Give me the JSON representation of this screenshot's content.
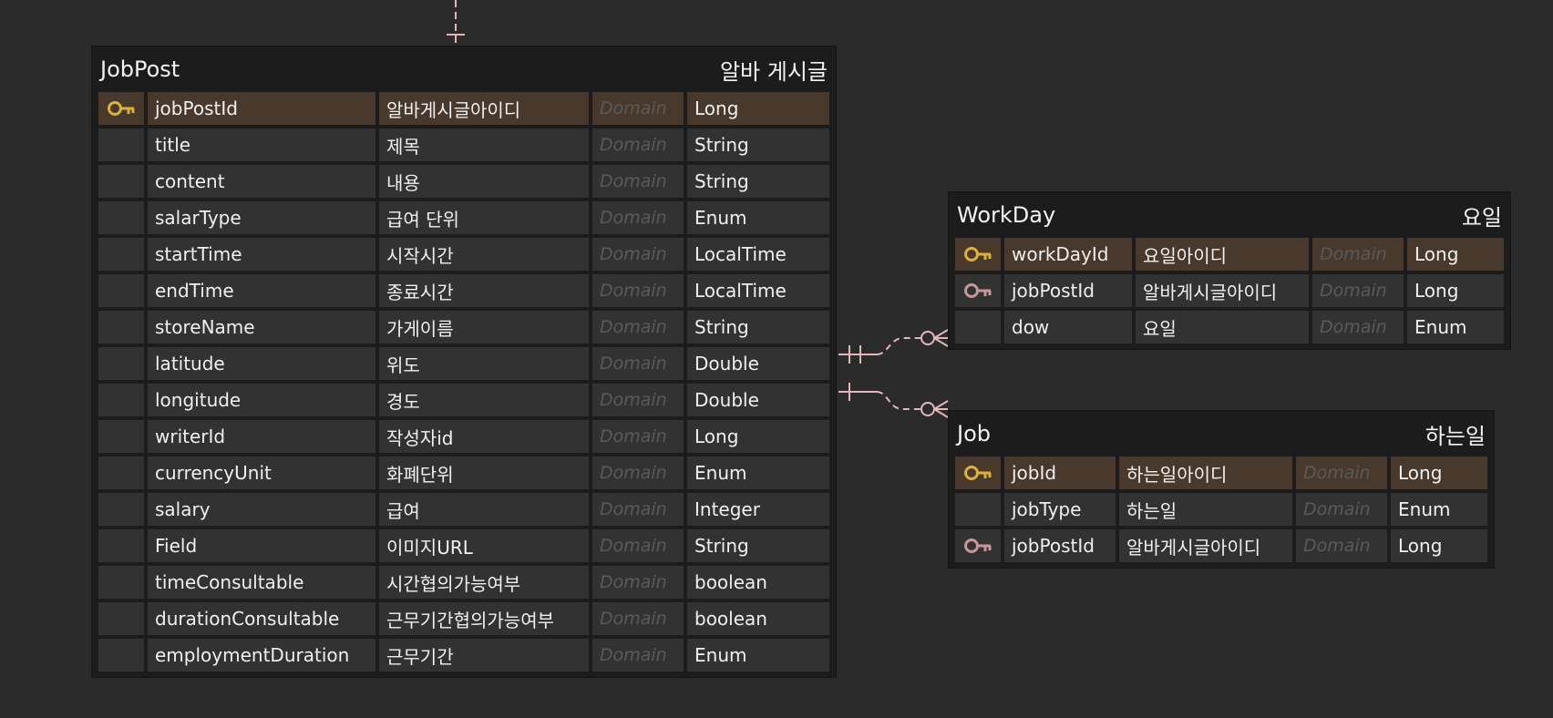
{
  "colors": {
    "background": "#2b2b2b",
    "table": "#1c1c1c",
    "cell": "#323232",
    "pk_cell": "#48392c",
    "pk_key": "#d9b13c",
    "fk_key": "#c9959d",
    "connector": "#e3b6bd"
  },
  "icons": {
    "pk": "key-icon",
    "fk": "foreign-key-icon"
  },
  "tables": [
    {
      "id": "jobpost",
      "name": "JobPost",
      "logical": "알바 게시글",
      "rows": [
        {
          "key": "pk",
          "column": "jobPostId",
          "logical": "알바게시글아이디",
          "domain": "Domain",
          "type": "Long"
        },
        {
          "key": "",
          "column": "title",
          "logical": "제목",
          "domain": "Domain",
          "type": "String"
        },
        {
          "key": "",
          "column": "content",
          "logical": "내용",
          "domain": "Domain",
          "type": "String"
        },
        {
          "key": "",
          "column": "salarType",
          "logical": "급여 단위",
          "domain": "Domain",
          "type": "Enum"
        },
        {
          "key": "",
          "column": "startTime",
          "logical": "시작시간",
          "domain": "Domain",
          "type": "LocalTime"
        },
        {
          "key": "",
          "column": "endTime",
          "logical": "종료시간",
          "domain": "Domain",
          "type": "LocalTime"
        },
        {
          "key": "",
          "column": "storeName",
          "logical": "가게이름",
          "domain": "Domain",
          "type": "String"
        },
        {
          "key": "",
          "column": "latitude",
          "logical": "위도",
          "domain": "Domain",
          "type": "Double"
        },
        {
          "key": "",
          "column": "longitude",
          "logical": "경도",
          "domain": "Domain",
          "type": "Double"
        },
        {
          "key": "",
          "column": "writerId",
          "logical": "작성자id",
          "domain": "Domain",
          "type": "Long"
        },
        {
          "key": "",
          "column": "currencyUnit",
          "logical": "화폐단위",
          "domain": "Domain",
          "type": "Enum"
        },
        {
          "key": "",
          "column": "salary",
          "logical": "급여",
          "domain": "Domain",
          "type": "Integer"
        },
        {
          "key": "",
          "column": "Field",
          "logical": "이미지URL",
          "domain": "Domain",
          "type": "String"
        },
        {
          "key": "",
          "column": "timeConsultable",
          "logical": "시간협의가능여부",
          "domain": "Domain",
          "type": "boolean"
        },
        {
          "key": "",
          "column": "durationConsultable",
          "logical": "근무기간협의가능여부",
          "domain": "Domain",
          "type": "boolean"
        },
        {
          "key": "",
          "column": "employmentDuration",
          "logical": "근무기간",
          "domain": "Domain",
          "type": "Enum"
        }
      ]
    },
    {
      "id": "workday",
      "name": "WorkDay",
      "logical": "요일",
      "rows": [
        {
          "key": "pk",
          "column": "workDayId",
          "logical": "요일아이디",
          "domain": "Domain",
          "type": "Long"
        },
        {
          "key": "fk",
          "column": "jobPostId",
          "logical": "알바게시글아이디",
          "domain": "Domain",
          "type": "Long"
        },
        {
          "key": "",
          "column": "dow",
          "logical": "요일",
          "domain": "Domain",
          "type": "Enum"
        }
      ]
    },
    {
      "id": "job",
      "name": "Job",
      "logical": "하는일",
      "rows": [
        {
          "key": "pk",
          "column": "jobId",
          "logical": "하는일아이디",
          "domain": "Domain",
          "type": "Long"
        },
        {
          "key": "",
          "column": "jobType",
          "logical": "하는일",
          "domain": "Domain",
          "type": "Enum"
        },
        {
          "key": "fk",
          "column": "jobPostId",
          "logical": "알바게시글아이디",
          "domain": "Domain",
          "type": "Long"
        }
      ]
    }
  ],
  "relationships": [
    {
      "from": "JobPost",
      "to": "WorkDay",
      "cardinality": "one-to-zero-or-many"
    },
    {
      "from": "JobPost",
      "to": "Job",
      "cardinality": "one-to-zero-or-many"
    }
  ]
}
